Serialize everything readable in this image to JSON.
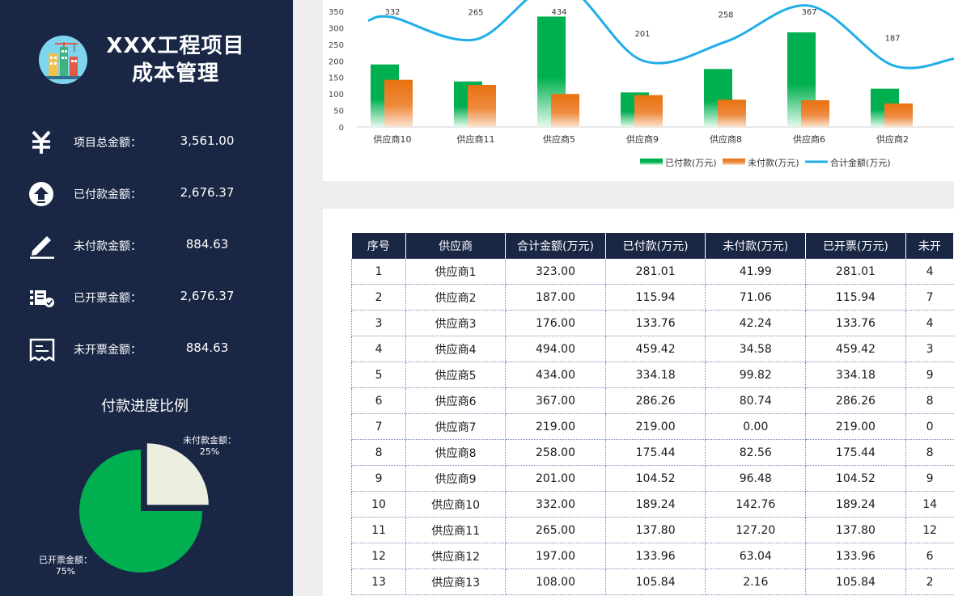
{
  "app": {
    "title_line1": "XXX工程项目",
    "title_line2": "成本管理"
  },
  "summary": [
    {
      "icon": "yen-icon",
      "label": "项目总金额：",
      "value": "3,561.00"
    },
    {
      "icon": "upload-icon",
      "label": "已付款金额：",
      "value": "2,676.37"
    },
    {
      "icon": "pen-icon",
      "label": "未付款金额：",
      "value": "884.63"
    },
    {
      "icon": "invoice-check-icon",
      "label": "已开票金额：",
      "value": "2,676.37"
    },
    {
      "icon": "receipt-icon",
      "label": "未开票金额：",
      "value": "884.63"
    }
  ],
  "pie": {
    "title": "付款进度比例",
    "slices": [
      {
        "label": "未付款金额：",
        "pct": "25%",
        "value": 25,
        "color": "#ecefe0"
      },
      {
        "label": "已开票金额：",
        "pct": "75%",
        "value": 75,
        "color": "#00b050"
      }
    ]
  },
  "chart_data": {
    "type": "bar",
    "categories": [
      "供应商10",
      "供应商11",
      "供应商5",
      "供应商9",
      "供应商8",
      "供应商6",
      "供应商2"
    ],
    "series": [
      {
        "name": "已付款(万元)",
        "type": "bar",
        "color": "#00b050",
        "values": [
          189.24,
          137.8,
          334.18,
          104.52,
          175.44,
          286.26,
          115.94
        ]
      },
      {
        "name": "未付款(万元)",
        "type": "bar",
        "color": "#e8710f",
        "values": [
          142.76,
          127.2,
          99.82,
          96.48,
          82.56,
          80.74,
          71.06
        ]
      },
      {
        "name": "合计金额(万元)",
        "type": "line",
        "color": "#1faee8",
        "values": [
          332,
          265,
          434,
          201,
          258,
          367,
          187
        ]
      }
    ],
    "y_ticks": [
      0,
      50,
      100,
      150,
      200,
      250,
      300,
      350
    ],
    "ylim": [
      0,
      350
    ],
    "legend": "bottom"
  },
  "table": {
    "headers": [
      "序号",
      "供应商",
      "合计金额(万元)",
      "已付款(万元)",
      "未付款(万元)",
      "已开票(万元)",
      "未开"
    ],
    "rows": [
      [
        "1",
        "供应商1",
        "323.00",
        "281.01",
        "41.99",
        "281.01",
        "4"
      ],
      [
        "2",
        "供应商2",
        "187.00",
        "115.94",
        "71.06",
        "115.94",
        "7"
      ],
      [
        "3",
        "供应商3",
        "176.00",
        "133.76",
        "42.24",
        "133.76",
        "4"
      ],
      [
        "4",
        "供应商4",
        "494.00",
        "459.42",
        "34.58",
        "459.42",
        "3"
      ],
      [
        "5",
        "供应商5",
        "434.00",
        "334.18",
        "99.82",
        "334.18",
        "9"
      ],
      [
        "6",
        "供应商6",
        "367.00",
        "286.26",
        "80.74",
        "286.26",
        "8"
      ],
      [
        "7",
        "供应商7",
        "219.00",
        "219.00",
        "0.00",
        "219.00",
        "0"
      ],
      [
        "8",
        "供应商8",
        "258.00",
        "175.44",
        "82.56",
        "175.44",
        "8"
      ],
      [
        "9",
        "供应商9",
        "201.00",
        "104.52",
        "96.48",
        "104.52",
        "9"
      ],
      [
        "10",
        "供应商10",
        "332.00",
        "189.24",
        "142.76",
        "189.24",
        "14"
      ],
      [
        "11",
        "供应商11",
        "265.00",
        "137.80",
        "127.20",
        "137.80",
        "12"
      ],
      [
        "12",
        "供应商12",
        "197.00",
        "133.96",
        "63.04",
        "133.96",
        "6"
      ],
      [
        "13",
        "供应商13",
        "108.00",
        "105.84",
        "2.16",
        "105.84",
        "2"
      ]
    ]
  }
}
